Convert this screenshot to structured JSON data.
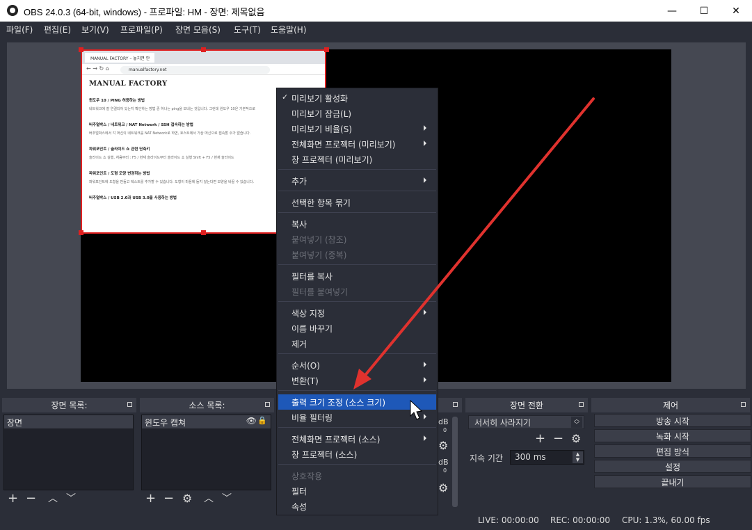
{
  "window": {
    "title": "OBS 24.0.3 (64-bit, windows) - 프로파일: HM - 장면: 제목없음",
    "minimize_glyph": "—",
    "maximize_glyph": "☐",
    "close_glyph": "✕"
  },
  "menubar": [
    "파일(F)",
    "편집(E)",
    "보기(V)",
    "프로파일(P)",
    "장면 모음(S)",
    "도구(T)",
    "도움말(H)"
  ],
  "browser_capture": {
    "tab_title": "MANUAL FACTORY – 놓치면 안",
    "url": "manualfactory.net",
    "site_title": "MANUAL FACTORY",
    "posts": [
      {
        "title": "윈도우 10 / PING 허용하는 방법",
        "excerpt": "네트워크에 잘 연결되어 있는지 확인하는 방법 중 하나는 ping을 보내는 것입니다. 그런데 윈도우 10은 기본적으로"
      },
      {
        "title": "버추얼박스 / 네트워크 / NAT Network / SSH 접속하는 방법",
        "excerpt": "버추얼박스에서 각 머신의 네트워크를 NAT Network로 하면, 호스트에서 가상 머신으로 접속할 수가 없습니다."
      },
      {
        "title": "파워포인트 / 슬라이드 쇼 관련 단축키",
        "excerpt": "슬라이드 쇼 실행, 처음부터 : F5 / 현재 슬라이드부터 슬라이드 쇼 실행 Shift + F5 / 현재 슬라이드"
      },
      {
        "title": "파워포인트 / 도형 모양 변경하는 방법",
        "excerpt": "파워포인트에 도형을 만들고 텍스트를 추가할 수 있습니다. 도형이 마음에 들지 않는다면 모양을 바꿀 수 있습니다."
      },
      {
        "title": "버추얼박스 / USB 2.0과 USB 3.0을 사용하는 방법",
        "excerpt": ""
      }
    ]
  },
  "context_menu": {
    "items": [
      {
        "label": "미리보기 활성화",
        "checked": true
      },
      {
        "label": "미리보기 잠금(L)"
      },
      {
        "label": "미리보기 비율(S)",
        "submenu": true
      },
      {
        "label": "전체화면 프로젝터 (미리보기)",
        "submenu": true
      },
      {
        "label": "창 프로젝터 (미리보기)"
      },
      {
        "label": "추가",
        "submenu": true
      },
      {
        "label": "선택한 항목 묶기"
      },
      {
        "label": "복사"
      },
      {
        "label": "붙여넣기 (참조)",
        "disabled": true
      },
      {
        "label": "붙여넣기 (중복)",
        "disabled": true
      },
      {
        "label": "필터를 복사"
      },
      {
        "label": "필터를 붙여넣기",
        "disabled": true
      },
      {
        "label": "색상 지정",
        "submenu": true
      },
      {
        "label": "이름 바꾸기"
      },
      {
        "label": "제거"
      },
      {
        "label": "순서(O)",
        "submenu": true
      },
      {
        "label": "변환(T)",
        "submenu": true
      },
      {
        "label": "출력 크기 조정 (소스 크기)",
        "highlighted": true
      },
      {
        "label": "비율 필터링",
        "submenu": true
      },
      {
        "label": "전체화면 프로젝터 (소스)",
        "submenu": true
      },
      {
        "label": "창 프로젝터 (소스)"
      },
      {
        "label": "상호작용",
        "disabled": true
      },
      {
        "label": "필터"
      },
      {
        "label": "속성"
      }
    ]
  },
  "docks": {
    "scenes": {
      "title": "장면 목록:",
      "items": [
        "장면"
      ]
    },
    "sources": {
      "title": "소스 목록:",
      "items": [
        "윈도우 캡쳐"
      ]
    },
    "mixer": {
      "db1": "dB",
      "db2": "dB",
      "zero1": "0",
      "zero2": "0"
    },
    "transitions": {
      "title": "장면 전환",
      "selected": "서서히 사라지기",
      "duration_label": "지속 기간",
      "duration_value": "300 ms"
    },
    "controls": {
      "title": "제어",
      "buttons": [
        "방송 시작",
        "녹화 시작",
        "편집 방식",
        "설정",
        "끝내기"
      ]
    }
  },
  "status": {
    "live": "LIVE: 00:00:00",
    "rec": "REC: 00:00:00",
    "cpu": "CPU: 1.3%, 60.00 fps"
  },
  "colors": {
    "accent_highlight": "#1e58b8",
    "selection_border": "#e02020",
    "annotation_arrow": "#e0322e"
  }
}
